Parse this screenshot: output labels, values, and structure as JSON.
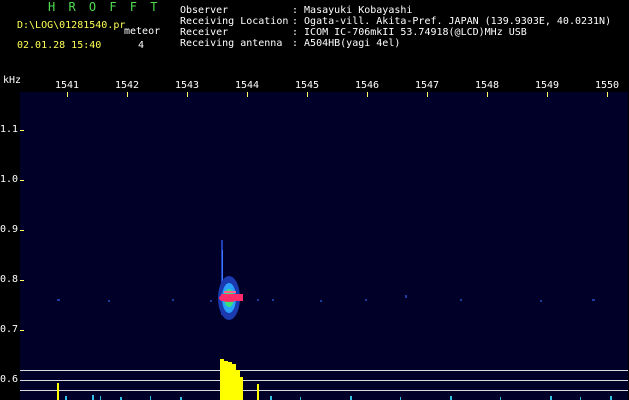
{
  "header": {
    "brand": "H R O F F T",
    "logfile": "D:\\LOG\\01281540.pr",
    "datetime": "02.01.28 15:40",
    "tag": "meteor",
    "count": "4"
  },
  "info": {
    "labels": [
      "Observer",
      "Receiving Location",
      "Receiver",
      "Receiving antenna"
    ],
    "values": [
      ": Masayuki Kobayashi",
      ": Ogata-vill. Akita-Pref. JAPAN (139.9303E, 40.0231N)",
      ": ICOM IC-706mkII 53.74918(@LCD)MHz USB",
      ": A504HB(yagi 4el)"
    ]
  },
  "axes": {
    "x_unit": "kHz",
    "x_ticks": [
      "1541",
      "1542",
      "1543",
      "1544",
      "1545",
      "1546",
      "1547",
      "1548",
      "1549",
      "1550"
    ],
    "y_ticks": [
      "1.1",
      "1.0",
      "0.9",
      "0.8",
      "0.7",
      "0.6"
    ]
  },
  "colors": {
    "background": "#000000",
    "plot_background": "#000029",
    "tick": "#ffff55",
    "label_green": "#4fdc4f",
    "echo_core": "#ff2a6a",
    "echo_mid": "#31c3ff",
    "spectrum": "#ffff00",
    "noise": "#33c0e8"
  }
}
